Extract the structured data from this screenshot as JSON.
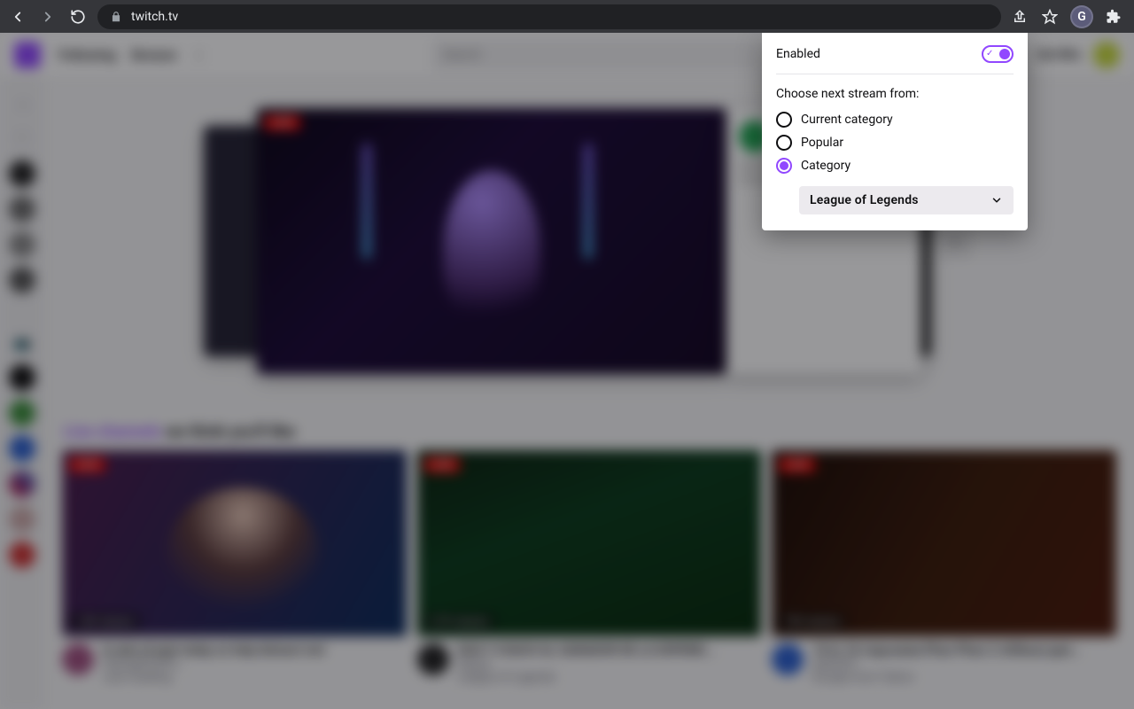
{
  "browser": {
    "url": "twitch.tv"
  },
  "ext": {
    "enabled_label": "Enabled",
    "choose_label": "Choose next stream from:",
    "options": {
      "current": "Current category",
      "popular": "Popular",
      "category": "Category"
    },
    "selected_category": "League of Legends",
    "badge_letter": "G"
  },
  "twitch": {
    "nav": {
      "following": "Following",
      "browse": "Browse"
    },
    "search_placeholder": "Search",
    "get_bits": "Get Bits",
    "section_purple": "Live channels",
    "section_rest": " we think you'll like",
    "live_word": "LIVE",
    "cards": [
      {
        "title": "In alot of pain today so help distract me!",
        "streamer": "HannahPocPit...",
        "category": "Just Chatting",
        "viewers": "1.4K viewers"
      },
      {
        "title": "DUO Y COACH AL GANADOR DE LA EXPERIE...",
        "streamer": "elyoya",
        "category": "League of Legends",
        "viewers": "5.7K viewers"
      },
      {
        "title": "10 to 10 отдыхаем.Phas-Phas-2 chillныя дне...",
        "streamer": "dobriii07",
        "category": "Escape from Tarkov",
        "viewers": "790 viewers"
      }
    ]
  }
}
